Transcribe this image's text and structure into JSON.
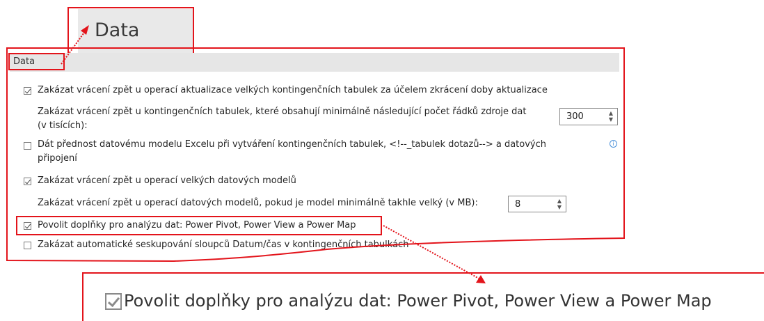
{
  "zoom_top": {
    "title": "Data"
  },
  "section": {
    "title": "Data"
  },
  "options": {
    "disable_undo_large_pivot": {
      "label": "Zakázat vrácení zpět u operací aktualizace velkých kontingenčních tabulek za účelem zkrácení doby aktualizace",
      "checked": true
    },
    "min_rows": {
      "label_line1": "Zakázat vrácení zpět u kontingenčních tabulek, které obsahují minimálně následující počet řádků zdroje dat",
      "label_line2": "(v tisících):",
      "value": "300"
    },
    "prefer_data_model": {
      "label_line1": "Dát přednost datovému modelu Excelu při vytváření kontingenčních tabulek, <!--_tabulek dotazů--> a datových",
      "label_line2": "připojení",
      "checked": false
    },
    "disable_undo_large_model": {
      "label": "Zakázat vrácení zpět u operací velkých datových modelů",
      "checked": true
    },
    "min_model_size": {
      "label": "Zakázat vrácení zpět u operací datových modelů, pokud je model minimálně takhle velký (v MB):",
      "value": "8"
    },
    "enable_addins": {
      "label": "Povolit doplňky pro analýzu dat: Power Pivot, Power View a Power Map",
      "checked": true
    },
    "disable_auto_grouping": {
      "label": "Zakázat automatické seskupování sloupců Datum/čas v kontingenčních tabulkách",
      "checked": false
    }
  },
  "zoom_bottom": {
    "label": "Povolit doplňky pro analýzu dat: Power Pivot, Power View a Power Map",
    "checked": true
  },
  "colors": {
    "highlight": "#e3141b",
    "header_bg": "#e6e6e6",
    "info": "#4a90d9"
  }
}
